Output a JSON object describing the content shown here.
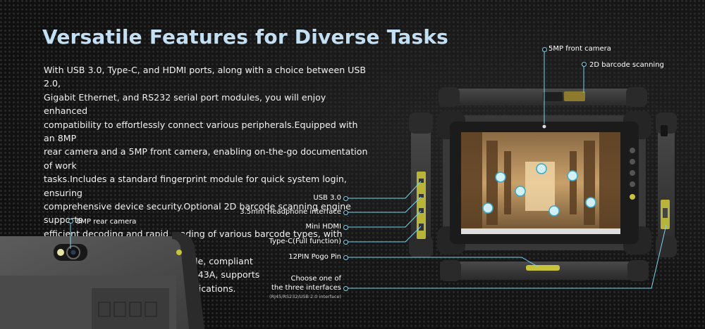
{
  "heading": "Versatile Features for Diverse Tasks",
  "description": "With USB 3.0, Type-C, and HDMI ports, along with a choice between USB 2.0,\nGigabit Ethernet, and RS232 serial port modules, you will enjoy enhanced\ncompatibility to effortlessly connect various peripherals.Equipped with an 8MP\nrear camera and a 5MP front camera, enabling on-the-go documentation of work\ntasks.Includes a standard fingerprint module for quick system login, ensuring\ncomprehensive device security.Optional 2D barcode scanning engine supports\n efficient decoding and rapid reading of various barcode types, with options for\ncustomization.Optional NFC module, compliant\n with protocols such as ISO/IEC 14443A, supports\nmainstream NFC card reading applications.",
  "callouts": {
    "front_camera": "5MP front camera",
    "barcode": "2D barcode scanning",
    "rear_camera": "8MP rear camera",
    "usb3": "USB 3.0",
    "headphone": "3.5mm  Headphone interface",
    "mini_hdmi": "Mini HDMI",
    "type_c": "Type-C(Full function)",
    "pogo": "12PIN Pogo Pin",
    "choose_line1": "Choose one of",
    "choose_line2": "the three interfaces",
    "choose_note": "(RJ45/RS232/USB 2.0 interface)"
  },
  "colors": {
    "background": "#141414",
    "heading": "#c3dff3",
    "leader_line": "#7bd3ee",
    "port_accent": "#c8c43a"
  },
  "icons": [
    "camera-lens-icon",
    "flash-icon",
    "barcode-window-icon",
    "fingerprint-icon",
    "pogo-pin-icon"
  ]
}
